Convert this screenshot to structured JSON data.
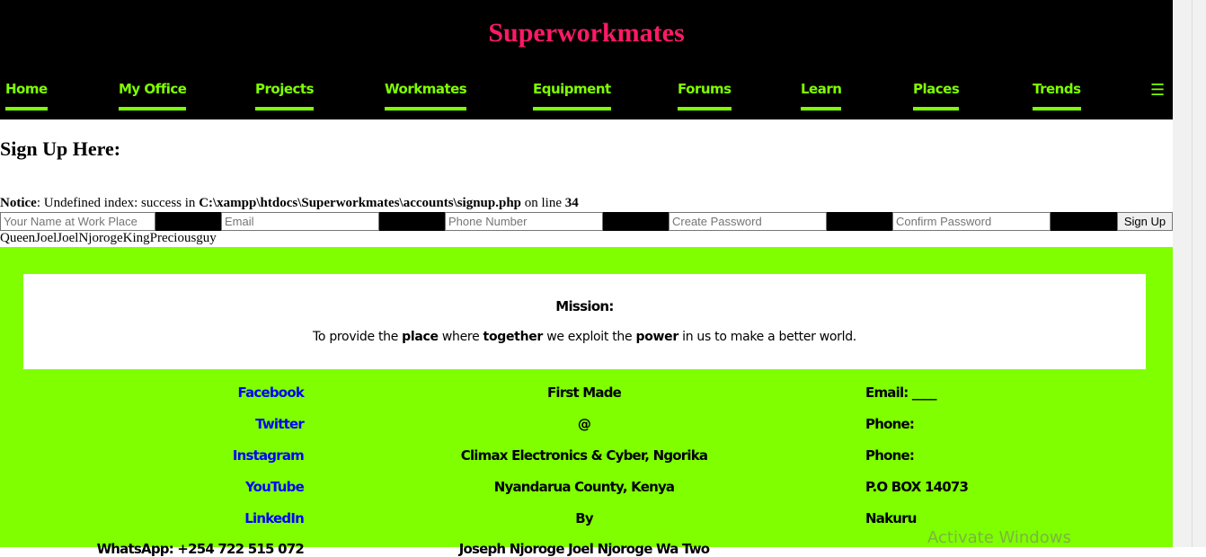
{
  "site": {
    "title": "Superworkmates"
  },
  "nav": {
    "items": [
      {
        "label": "Home"
      },
      {
        "label": "My Office"
      },
      {
        "label": "Projects"
      },
      {
        "label": "Workmates"
      },
      {
        "label": "Equipment"
      },
      {
        "label": "Forums"
      },
      {
        "label": "Learn"
      },
      {
        "label": "Places"
      },
      {
        "label": "Trends"
      }
    ],
    "menu_icon": "☰"
  },
  "main": {
    "heading": "Sign Up Here:",
    "notice": {
      "label": "Notice",
      "text1": ": Undefined index: success in ",
      "path": "C:\\xampp\\htdocs\\Superworkmates\\accounts\\signup.php",
      "text2": " on line ",
      "line": "34"
    },
    "form": {
      "name_placeholder": "Your Name at Work Place",
      "email_placeholder": "Email",
      "phone_placeholder": "Phone Number",
      "password_placeholder": "Create Password",
      "confirm_placeholder": "Confirm Password",
      "submit_label": "Sign Up"
    },
    "names_text": "QueenJoelJoelNjorogeKingPreciousguy"
  },
  "footer": {
    "mission": {
      "title": "Mission:",
      "t1": "To provide the ",
      "b1": "place",
      "t2": " where ",
      "b2": "together",
      "t3": " we exploit the ",
      "b3": "power",
      "t4": " in us to make a better world."
    },
    "social": [
      "Facebook",
      "Twitter",
      "Instagram",
      "YouTube",
      "LinkedIn",
      "WhatsApp: +254 722 515 072"
    ],
    "middle": [
      "First Made",
      "@",
      "Climax Electronics & Cyber, Ngorika",
      "Nyandarua County, Kenya",
      "By",
      "Joseph Njoroge Joel Njoroge Wa Two"
    ],
    "contact": [
      "Email: ____",
      "Phone:",
      "Phone:",
      "P.O BOX 14073",
      "Nakuru"
    ]
  },
  "watermark": "Activate Windows",
  "colors": {
    "nav_green": "#7fff00",
    "title_pink": "#ff1a66",
    "footer_bg": "#7fff00",
    "link_blue": "#0000ff"
  }
}
